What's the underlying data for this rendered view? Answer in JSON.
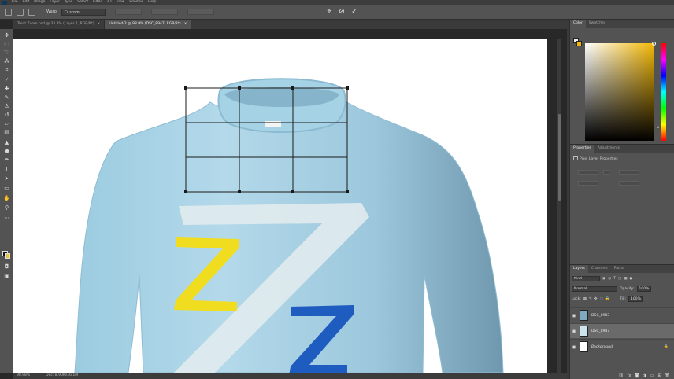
{
  "menu": [
    "File",
    "Edit",
    "Image",
    "Layer",
    "Type",
    "Select",
    "Filter",
    "3D",
    "View",
    "Window",
    "Help"
  ],
  "options": {
    "warp_label": "Warp:",
    "warp_value": "Custom",
    "commit_icons": [
      "cancel-transform-icon",
      "commit-icon"
    ]
  },
  "document_tabs": [
    {
      "label": "Treat Zoom.psd @ 33.3% (Layer 1, RGB/8*)",
      "active": false
    },
    {
      "label": "Untitled-2 @ 98.9% (DSC_8947, RGB/8*)",
      "active": true
    }
  ],
  "status": {
    "zoom": "98.98%",
    "doc": "Doc: 8.90M/36.1M"
  },
  "colors": {
    "foreground": "#f2f2f2",
    "background": "#f2b705",
    "shirt": "#a9d3e6",
    "yellow_z": "#f1dd20",
    "blue_z": "#1f5cc0"
  },
  "panels": {
    "color_tabs": [
      "Color",
      "Swatches"
    ],
    "props_tabs": [
      "Properties",
      "Adjustments"
    ],
    "props_title": "Pixel Layer Properties",
    "layer_tabs": [
      "Layers",
      "Channels",
      "Paths"
    ],
    "kind_label": "Kind",
    "blend_mode": "Normal",
    "opacity_label": "Opacity:",
    "opacity_value": "100%",
    "lock_label": "Lock:",
    "fill_label": "Fill:",
    "fill_value": "100%"
  },
  "layers": [
    {
      "name": "DSC_8903",
      "selected": false,
      "thumb": "#7fa9c0"
    },
    {
      "name": "DSC_8947",
      "selected": true,
      "thumb": "#cde4ef"
    },
    {
      "name": "Background",
      "selected": false,
      "thumb": "#ffffff",
      "locked": true
    }
  ]
}
